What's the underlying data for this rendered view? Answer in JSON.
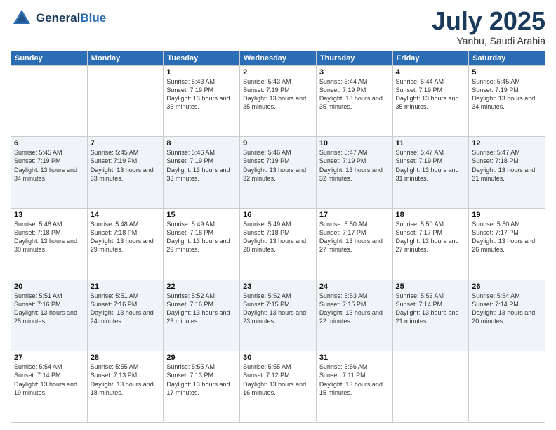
{
  "header": {
    "logo_general": "General",
    "logo_blue": "Blue",
    "month": "July 2025",
    "location": "Yanbu, Saudi Arabia"
  },
  "days_of_week": [
    "Sunday",
    "Monday",
    "Tuesday",
    "Wednesday",
    "Thursday",
    "Friday",
    "Saturday"
  ],
  "weeks": [
    [
      {
        "day": "",
        "info": ""
      },
      {
        "day": "",
        "info": ""
      },
      {
        "day": "1",
        "info": "Sunrise: 5:43 AM\nSunset: 7:19 PM\nDaylight: 13 hours and 36 minutes."
      },
      {
        "day": "2",
        "info": "Sunrise: 5:43 AM\nSunset: 7:19 PM\nDaylight: 13 hours and 35 minutes."
      },
      {
        "day": "3",
        "info": "Sunrise: 5:44 AM\nSunset: 7:19 PM\nDaylight: 13 hours and 35 minutes."
      },
      {
        "day": "4",
        "info": "Sunrise: 5:44 AM\nSunset: 7:19 PM\nDaylight: 13 hours and 35 minutes."
      },
      {
        "day": "5",
        "info": "Sunrise: 5:45 AM\nSunset: 7:19 PM\nDaylight: 13 hours and 34 minutes."
      }
    ],
    [
      {
        "day": "6",
        "info": "Sunrise: 5:45 AM\nSunset: 7:19 PM\nDaylight: 13 hours and 34 minutes."
      },
      {
        "day": "7",
        "info": "Sunrise: 5:45 AM\nSunset: 7:19 PM\nDaylight: 13 hours and 33 minutes."
      },
      {
        "day": "8",
        "info": "Sunrise: 5:46 AM\nSunset: 7:19 PM\nDaylight: 13 hours and 33 minutes."
      },
      {
        "day": "9",
        "info": "Sunrise: 5:46 AM\nSunset: 7:19 PM\nDaylight: 13 hours and 32 minutes."
      },
      {
        "day": "10",
        "info": "Sunrise: 5:47 AM\nSunset: 7:19 PM\nDaylight: 13 hours and 32 minutes."
      },
      {
        "day": "11",
        "info": "Sunrise: 5:47 AM\nSunset: 7:19 PM\nDaylight: 13 hours and 31 minutes."
      },
      {
        "day": "12",
        "info": "Sunrise: 5:47 AM\nSunset: 7:18 PM\nDaylight: 13 hours and 31 minutes."
      }
    ],
    [
      {
        "day": "13",
        "info": "Sunrise: 5:48 AM\nSunset: 7:18 PM\nDaylight: 13 hours and 30 minutes."
      },
      {
        "day": "14",
        "info": "Sunrise: 5:48 AM\nSunset: 7:18 PM\nDaylight: 13 hours and 29 minutes."
      },
      {
        "day": "15",
        "info": "Sunrise: 5:49 AM\nSunset: 7:18 PM\nDaylight: 13 hours and 29 minutes."
      },
      {
        "day": "16",
        "info": "Sunrise: 5:49 AM\nSunset: 7:18 PM\nDaylight: 13 hours and 28 minutes."
      },
      {
        "day": "17",
        "info": "Sunrise: 5:50 AM\nSunset: 7:17 PM\nDaylight: 13 hours and 27 minutes."
      },
      {
        "day": "18",
        "info": "Sunrise: 5:50 AM\nSunset: 7:17 PM\nDaylight: 13 hours and 27 minutes."
      },
      {
        "day": "19",
        "info": "Sunrise: 5:50 AM\nSunset: 7:17 PM\nDaylight: 13 hours and 26 minutes."
      }
    ],
    [
      {
        "day": "20",
        "info": "Sunrise: 5:51 AM\nSunset: 7:16 PM\nDaylight: 13 hours and 25 minutes."
      },
      {
        "day": "21",
        "info": "Sunrise: 5:51 AM\nSunset: 7:16 PM\nDaylight: 13 hours and 24 minutes."
      },
      {
        "day": "22",
        "info": "Sunrise: 5:52 AM\nSunset: 7:16 PM\nDaylight: 13 hours and 23 minutes."
      },
      {
        "day": "23",
        "info": "Sunrise: 5:52 AM\nSunset: 7:15 PM\nDaylight: 13 hours and 23 minutes."
      },
      {
        "day": "24",
        "info": "Sunrise: 5:53 AM\nSunset: 7:15 PM\nDaylight: 13 hours and 22 minutes."
      },
      {
        "day": "25",
        "info": "Sunrise: 5:53 AM\nSunset: 7:14 PM\nDaylight: 13 hours and 21 minutes."
      },
      {
        "day": "26",
        "info": "Sunrise: 5:54 AM\nSunset: 7:14 PM\nDaylight: 13 hours and 20 minutes."
      }
    ],
    [
      {
        "day": "27",
        "info": "Sunrise: 5:54 AM\nSunset: 7:14 PM\nDaylight: 13 hours and 19 minutes."
      },
      {
        "day": "28",
        "info": "Sunrise: 5:55 AM\nSunset: 7:13 PM\nDaylight: 13 hours and 18 minutes."
      },
      {
        "day": "29",
        "info": "Sunrise: 5:55 AM\nSunset: 7:13 PM\nDaylight: 13 hours and 17 minutes."
      },
      {
        "day": "30",
        "info": "Sunrise: 5:55 AM\nSunset: 7:12 PM\nDaylight: 13 hours and 16 minutes."
      },
      {
        "day": "31",
        "info": "Sunrise: 5:56 AM\nSunset: 7:11 PM\nDaylight: 13 hours and 15 minutes."
      },
      {
        "day": "",
        "info": ""
      },
      {
        "day": "",
        "info": ""
      }
    ]
  ]
}
